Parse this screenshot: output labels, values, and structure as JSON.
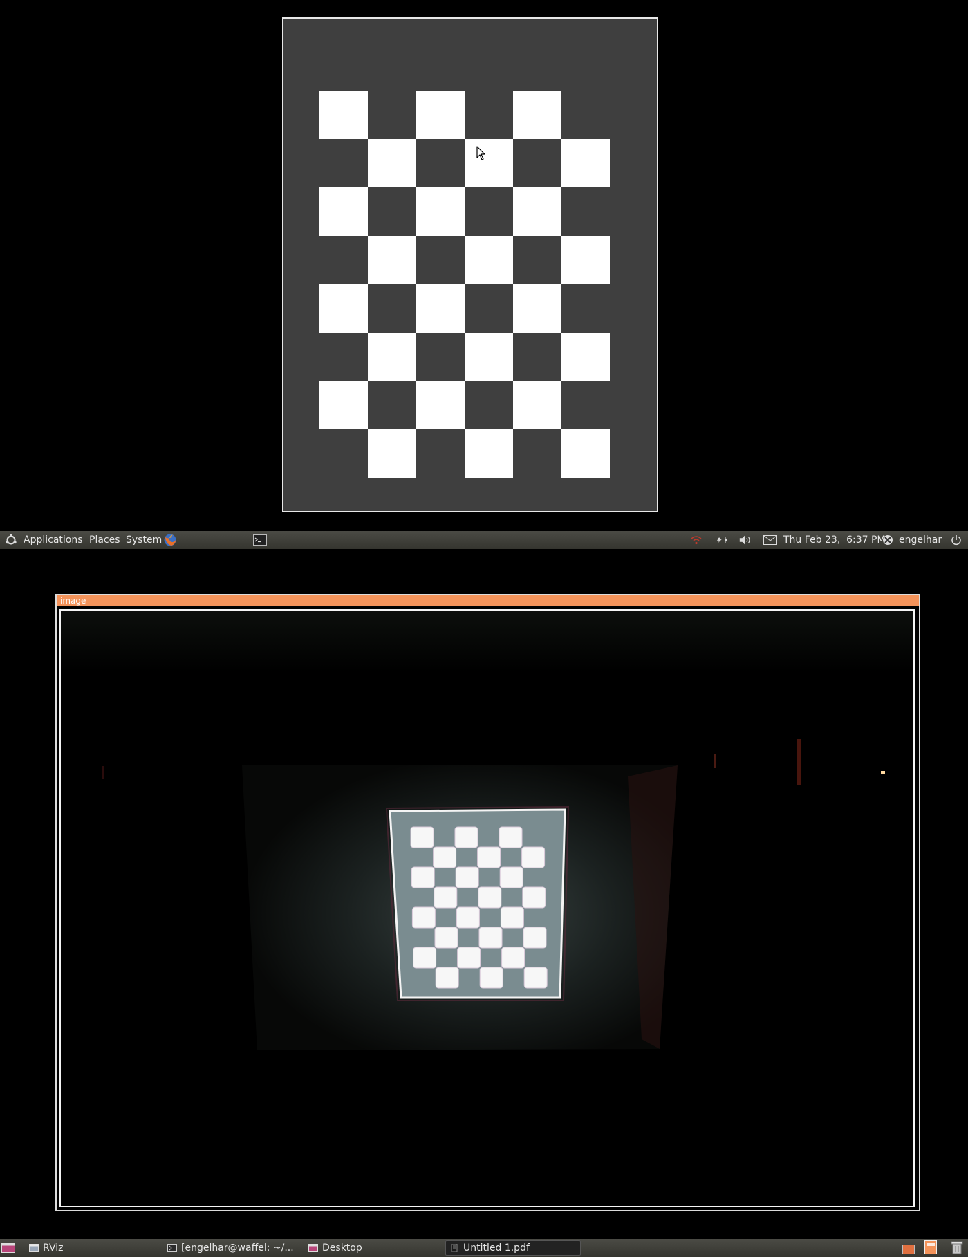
{
  "top_panel": {
    "menus": [
      "Applications",
      "Places",
      "System"
    ],
    "clock": "Thu Feb 23,  6:37 PM",
    "user": "engelhar"
  },
  "image_window": {
    "title": "image"
  },
  "taskbar": {
    "tasks": [
      {
        "label": "RViz",
        "icon": "rviz-window-icon"
      },
      {
        "label": "[engelhar@waffel: ~/...",
        "icon": "terminal-window-icon"
      },
      {
        "label": "Desktop",
        "icon": "desktop-window-icon"
      },
      {
        "label": "Untitled 1.pdf",
        "icon": "pdf-window-icon"
      }
    ]
  },
  "checkerboard": {
    "rows": 8,
    "cols": 6
  },
  "colors": {
    "panel_bg": "#3c3c37",
    "window_title_accent": "#f4935a",
    "checker_dark": "#3f3f3f",
    "checker_light": "#ffffff"
  }
}
